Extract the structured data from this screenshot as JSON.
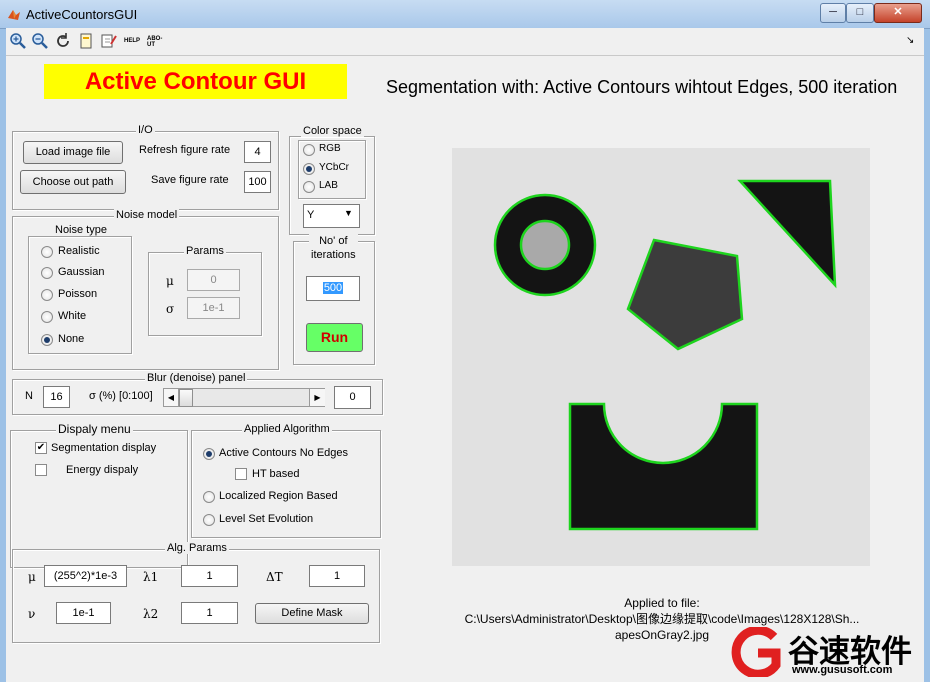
{
  "window": {
    "title": "ActiveCountorsGUI",
    "min": "─",
    "max": "□",
    "close": "✕"
  },
  "toolbar": {
    "help": "HELP",
    "about": "ABO-UT",
    "dock": "↘"
  },
  "header": {
    "app_title": "Active Contour GUI",
    "segmentation_title": "Segmentation with: Active Contours wihtout Edges, 500 iteration",
    "title_bg": "#ffff00",
    "title_color": "#ff0000"
  },
  "io": {
    "title": "I/O",
    "load_label": "Load image file",
    "chooseout_label": "Choose out path",
    "refresh_label": "Refresh figure rate",
    "refresh_value": "4",
    "save_label": "Save figure rate",
    "save_value": "100"
  },
  "color_space": {
    "title": "Color space",
    "options": [
      "RGB",
      "YCbCr",
      "LAB"
    ],
    "selected": "YCbCr",
    "channel": "Y"
  },
  "iterations": {
    "title_line1": "No' of",
    "title_line2": "iterations",
    "value": "500",
    "run_label": "Run",
    "run_color": "#66ff66"
  },
  "noise": {
    "title": "Noise model",
    "type_title": "Noise type",
    "types": [
      "Realistic",
      "Gaussian",
      "Poisson",
      "White",
      "None"
    ],
    "selected": "None",
    "params_title": "Params",
    "mu_symbol": "μ",
    "mu_value": "0",
    "sigma_symbol": "σ",
    "sigma_value": "1e-1"
  },
  "blur": {
    "title": "Blur (denoise) panel",
    "n_label": "N",
    "n_value": "16",
    "sigma_label": "σ (%) [0:100]",
    "slider_value": "0",
    "value": "0"
  },
  "display": {
    "title": "Dispaly menu",
    "segmentation_label": "Segmentation display",
    "segmentation_checked": true,
    "energy_label": "Energy dispaly",
    "energy_checked": false
  },
  "algorithm": {
    "title": "Applied Algorithm",
    "options": [
      "Active Contours No Edges",
      "Localized Region Based",
      "Level Set Evolution"
    ],
    "selected": "Active Contours No Edges",
    "ht_label": "HT based",
    "ht_checked": false
  },
  "alg_params": {
    "title": "Alg. Params",
    "mu_symbol": "μ",
    "mu_value": "(255^2)*1e-3",
    "nu_symbol": "ν",
    "nu_value": "1e-1",
    "lambda1_symbol": "λ1",
    "lambda1_value": "1",
    "lambda2_symbol": "λ2",
    "lambda2_value": "1",
    "dt_symbol": "ΔT",
    "dt_value": "1",
    "define_mask_label": "Define Mask"
  },
  "image": {
    "bg_color": "#e1e1e1",
    "shape_color": "#141414",
    "contour_color": "#1ed41e"
  },
  "file": {
    "label": "Applied to file:",
    "path_line1": "C:\\Users\\Administrator\\Desktop\\图像边缘提取\\code\\Images\\128X128\\Sh...",
    "path_line2": "apesOnGray2.jpg"
  },
  "watermark": {
    "text": "谷速软件",
    "url": "www.gususoft.com"
  }
}
